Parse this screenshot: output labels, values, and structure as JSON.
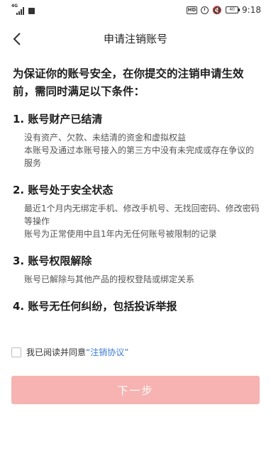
{
  "status_bar": {
    "network": "4G",
    "badge": "HD",
    "battery_level_percent": 40,
    "time": "9:18",
    "icons": [
      "signal-icon",
      "wechat-icon",
      "hd-icon",
      "alarm-icon",
      "mute-icon",
      "battery-icon"
    ]
  },
  "header": {
    "title": "申请注销账号",
    "back_icon": "chevron-left-icon"
  },
  "intro": "为保证你的账号安全，在你提交的注销申请生效前，需同时满足以下条件：",
  "conditions": [
    {
      "title": "1. 账号财产已结清",
      "lines": [
        "没有资产、欠款、未结清的资金和虚拟权益",
        "本账号及通过本账号接入的第三方中没有未完成或存在争议的服务"
      ]
    },
    {
      "title": "2. 账号处于安全状态",
      "lines": [
        "最近1个月内无绑定手机、修改手机号、无找回密码、修改密码等操作",
        "账号为正常使用中且1年内无任何账号被限制的记录"
      ]
    },
    {
      "title": "3. 账号权限解除",
      "lines": [
        "账号已解除与其他产品的授权登陆或绑定关系"
      ]
    },
    {
      "title": "4. 账号无任何纠纷，包括投诉举报",
      "lines": []
    }
  ],
  "agreement": {
    "checked": false,
    "prefix": "我已阅读并同意",
    "link": "“注销协议”"
  },
  "next_button": {
    "label": "下一步",
    "enabled": false,
    "color": "#f6b3b1"
  }
}
